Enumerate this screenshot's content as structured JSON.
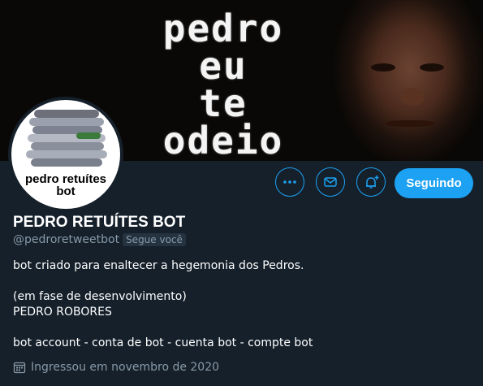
{
  "banner": {
    "lines": [
      "pedro",
      "eu",
      "te",
      "odeio"
    ]
  },
  "avatar": {
    "caption_lines": [
      "pedro retuítes",
      "bot"
    ]
  },
  "actions": {
    "more_icon": "more-icon",
    "message_icon": "mail-icon",
    "notify_icon": "bell-plus-icon",
    "follow_label": "Seguindo"
  },
  "profile": {
    "name": "PEDRO RETUÍTES BOT",
    "handle": "@pedroretweetbot",
    "follows_you": "Segue você",
    "bio": [
      "bot criado para enaltecer a hegemonia dos Pedros.",
      "",
      "(em fase de desenvolvimento)",
      "PEDRO ROBORES",
      "",
      "bot account - conta de bot - cuenta bot - compte bot"
    ],
    "joined": "Ingressou em novembro de 2020"
  },
  "colors": {
    "background": "#15202b",
    "accent": "#1da1f2",
    "secondary_text": "#8899a6"
  }
}
